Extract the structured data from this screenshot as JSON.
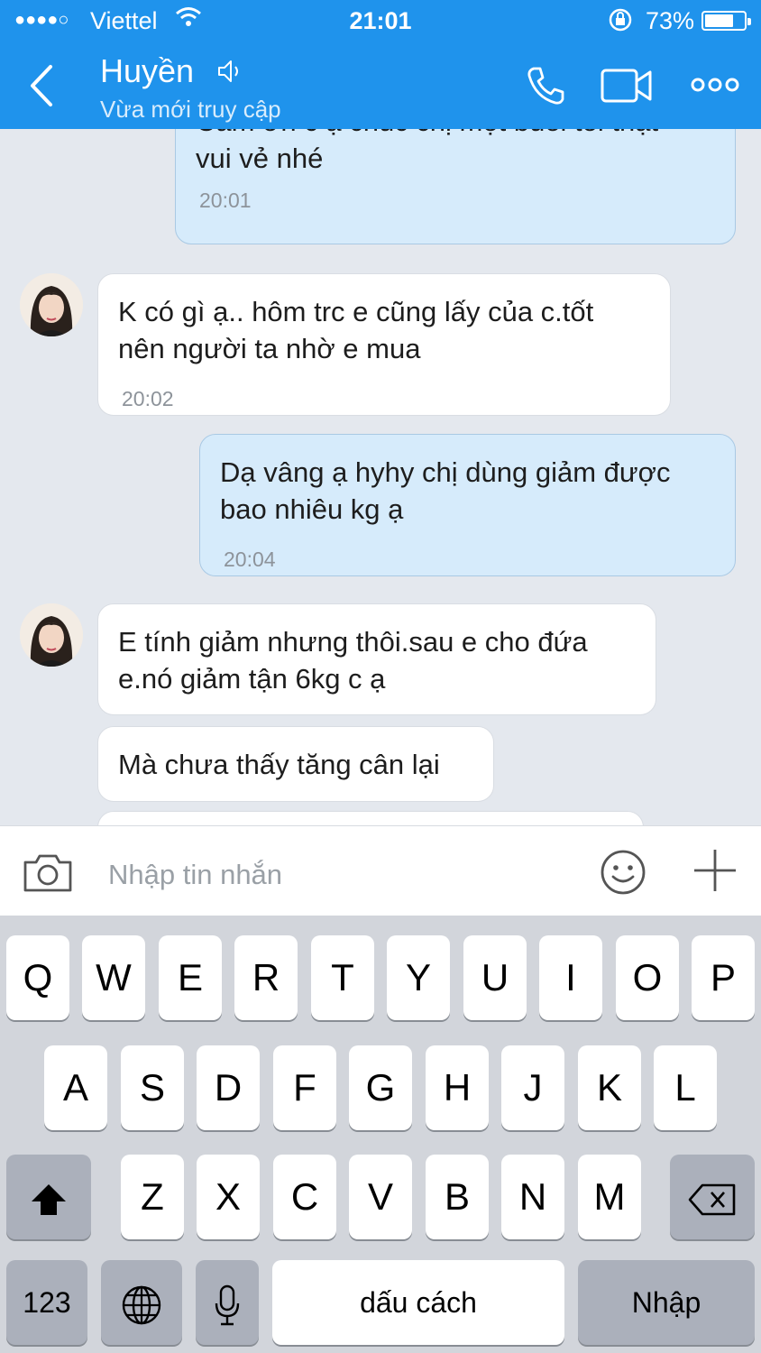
{
  "status_bar": {
    "signal": "●●●●○",
    "carrier": "Viettel",
    "time": "21:01",
    "battery": "73%",
    "battery_level": 0.73
  },
  "header": {
    "contact_name": "Huyền",
    "contact_status": "Vừa mới truy cập",
    "icons": [
      "back-icon",
      "speaker-icon",
      "phone-icon",
      "video-icon",
      "more-icon"
    ],
    "color": "#1f93ec"
  },
  "messages": [
    {
      "direction": "out",
      "lines": [
        "Cám ơn c ạ chúc chị một buổi tối thật",
        "vui vẻ nhé"
      ],
      "time": "20:01"
    },
    {
      "direction": "in",
      "lines": [
        "K có gì ạ.. hôm trc e cũng lấy của c.tốt",
        "nên người  ta nhờ e mua"
      ],
      "time": "20:02"
    },
    {
      "direction": "out",
      "lines": [
        "Dạ vâng ạ hyhy chị dùng giảm được",
        "bao nhiêu kg ạ"
      ],
      "time": "20:04"
    },
    {
      "direction": "in",
      "lines": [
        "E tính giảm nhưng thôi.sau e cho đứa",
        "e.nó giảm tận 6kg c ạ"
      ]
    },
    {
      "direction": "in",
      "lines": [
        "Mà chưa thấy tăng cân lại"
      ]
    }
  ],
  "composer": {
    "placeholder": "Nhập tin nhắn"
  },
  "keyboard": {
    "row1": [
      "Q",
      "W",
      "E",
      "R",
      "T",
      "Y",
      "U",
      "I",
      "O",
      "P"
    ],
    "row2": [
      "A",
      "S",
      "D",
      "F",
      "G",
      "H",
      "J",
      "K",
      "L"
    ],
    "row3": [
      "Z",
      "X",
      "C",
      "V",
      "B",
      "N",
      "M"
    ],
    "numbers_label": "123",
    "space_label": "dấu cách",
    "return_label": "Nhập"
  }
}
